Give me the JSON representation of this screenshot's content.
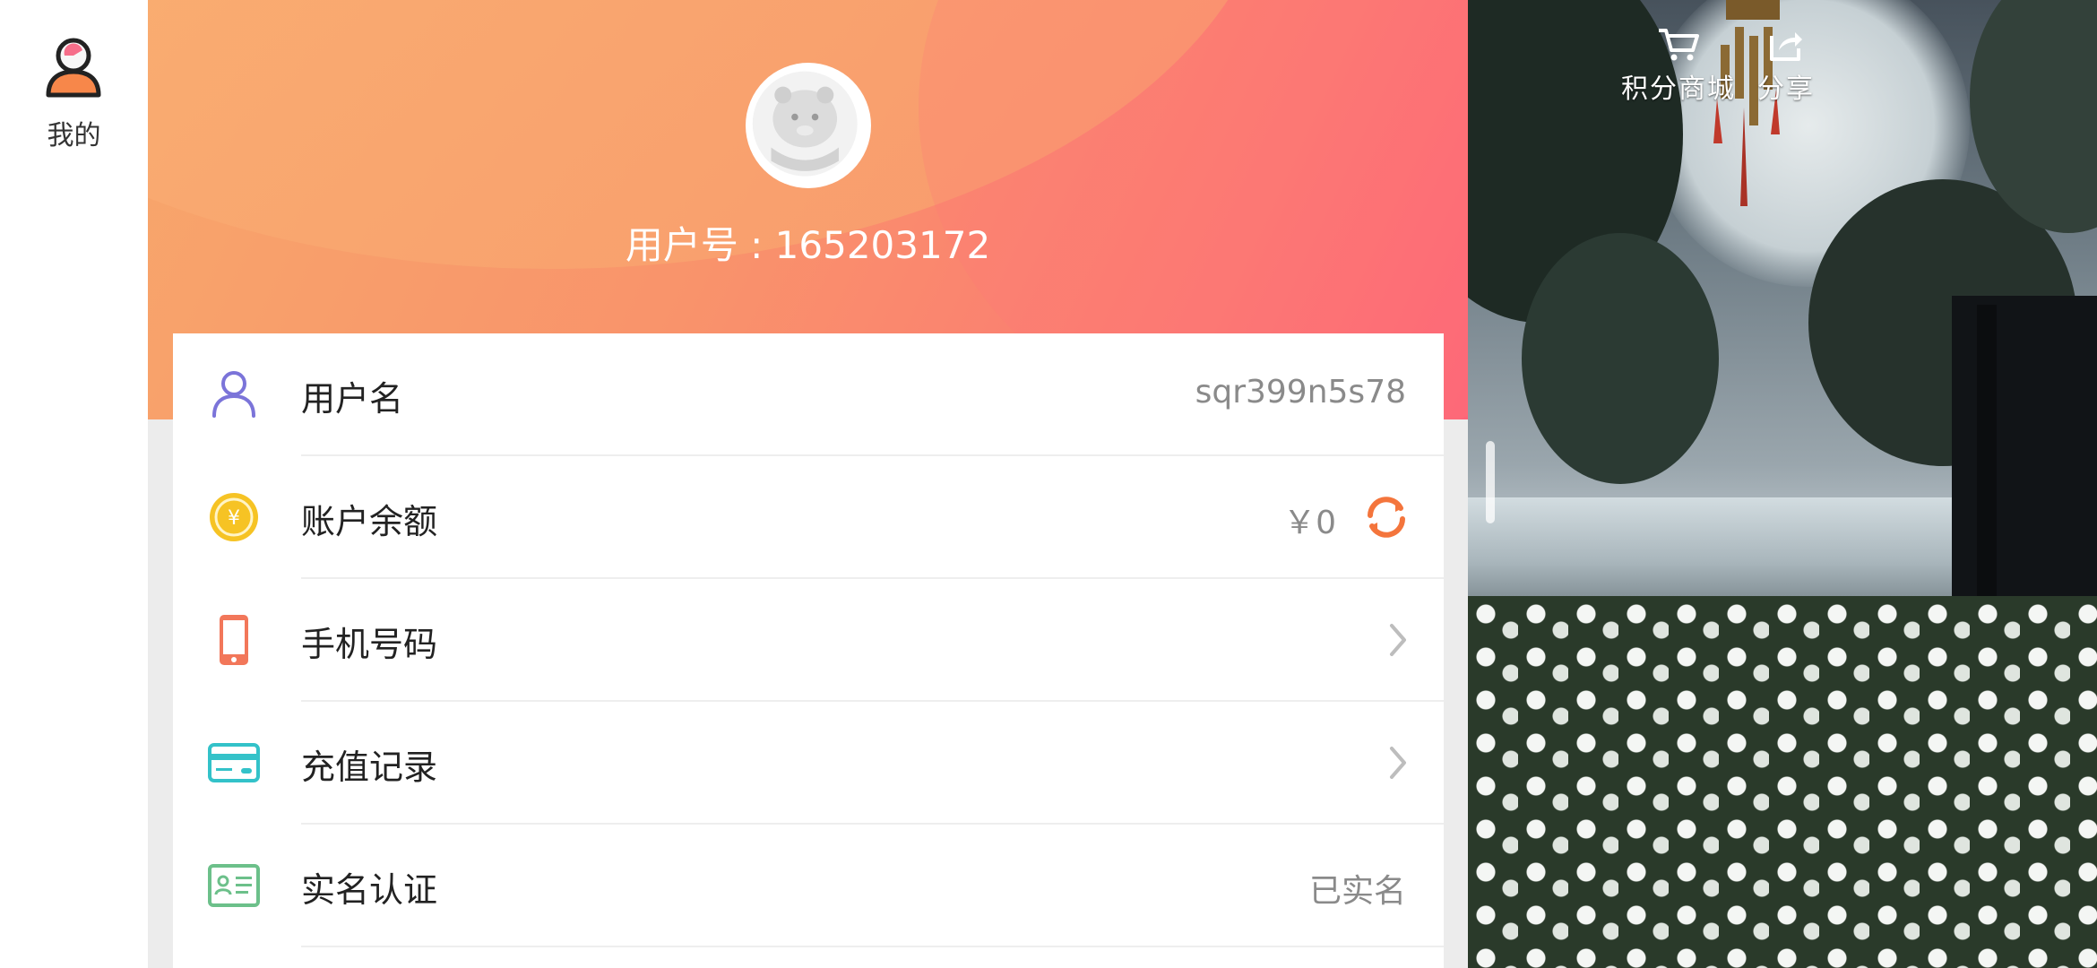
{
  "sidebar": {
    "tabs": [
      {
        "label": "我的",
        "icon": "user-icon"
      }
    ]
  },
  "profile": {
    "user_id_text": "用户号 : 165203172",
    "rows": [
      {
        "label": "用户名",
        "value": "sqr399n5s78",
        "icon": "person-icon"
      },
      {
        "label": "账户余额",
        "value": "￥0",
        "icon": "coin-icon",
        "action_icon": "refresh-icon"
      },
      {
        "label": "手机号码",
        "value": "",
        "icon": "phone-icon",
        "action_icon": "chevron-right-icon"
      },
      {
        "label": "充值记录",
        "value": "",
        "icon": "card-icon",
        "action_icon": "chevron-right-icon"
      },
      {
        "label": "实名认证",
        "value": "已实名",
        "icon": "id-card-icon"
      }
    ]
  },
  "scene": {
    "buttons": [
      {
        "label": "积分商城",
        "icon": "cart-icon"
      },
      {
        "label": "分享",
        "icon": "share-icon"
      }
    ]
  },
  "colors": {
    "header_start": "#f7a76b",
    "header_end": "#fd6478",
    "accent_orange": "#f4753c",
    "icon_purple": "#7b74d9",
    "icon_gold": "#f6c324",
    "icon_coral": "#f2775a",
    "icon_teal": "#33c2c9",
    "icon_green": "#6cc08a"
  }
}
